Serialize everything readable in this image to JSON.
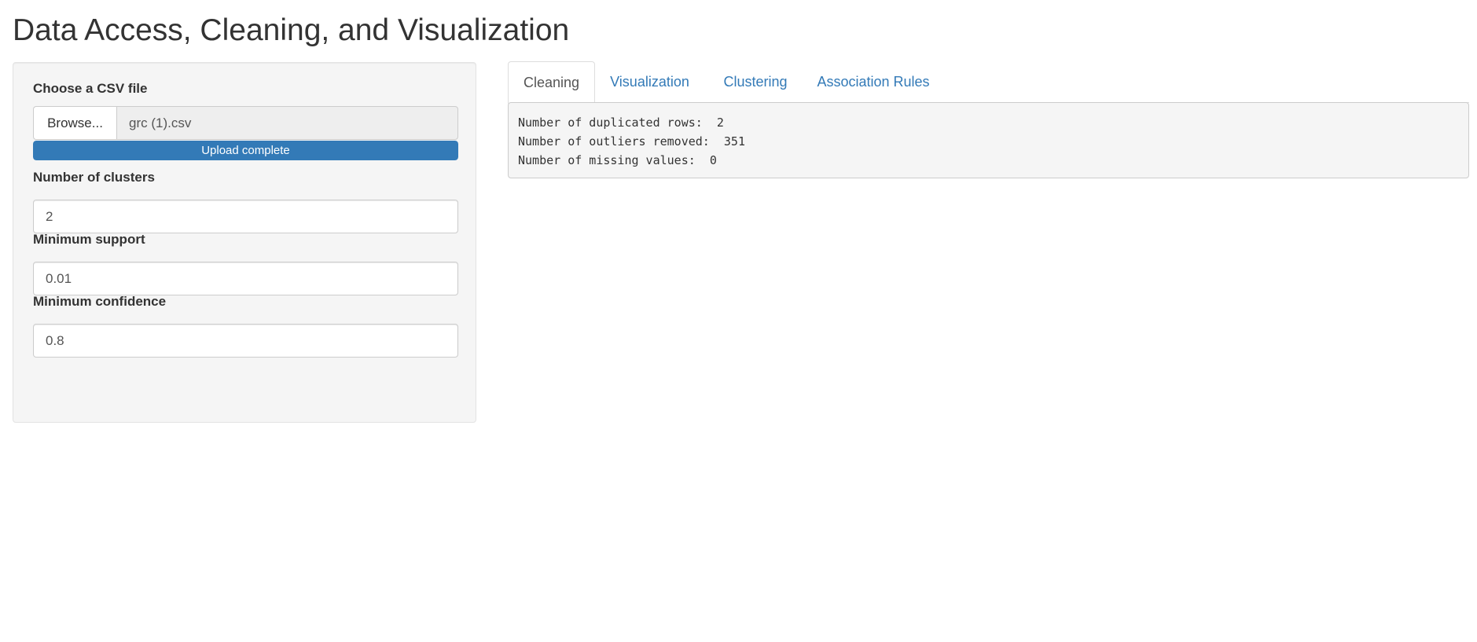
{
  "page": {
    "title": "Data Access, Cleaning, and Visualization"
  },
  "sidebar": {
    "file_input": {
      "label": "Choose a CSV file",
      "browse_label": "Browse...",
      "file_name": "grc (1).csv",
      "progress_label": "Upload complete",
      "progress_fraction": 1.0
    },
    "clusters": {
      "label": "Number of clusters",
      "value": "2"
    },
    "min_support": {
      "label": "Minimum support",
      "value": "0.01"
    },
    "min_confidence": {
      "label": "Minimum confidence",
      "value": "0.8"
    }
  },
  "main": {
    "tabs": [
      {
        "label": "Cleaning",
        "active": true
      },
      {
        "label": "Visualization",
        "active": false
      },
      {
        "label": "Clustering",
        "active": false
      },
      {
        "label": "Association Rules",
        "active": false
      }
    ],
    "output_lines": [
      "Number of duplicated rows:  2",
      "Number of outliers removed:  351",
      "Number of missing values:  0"
    ]
  },
  "colors": {
    "accent": "#337ab7",
    "panel_bg": "#f5f5f5",
    "text": "#333333"
  }
}
